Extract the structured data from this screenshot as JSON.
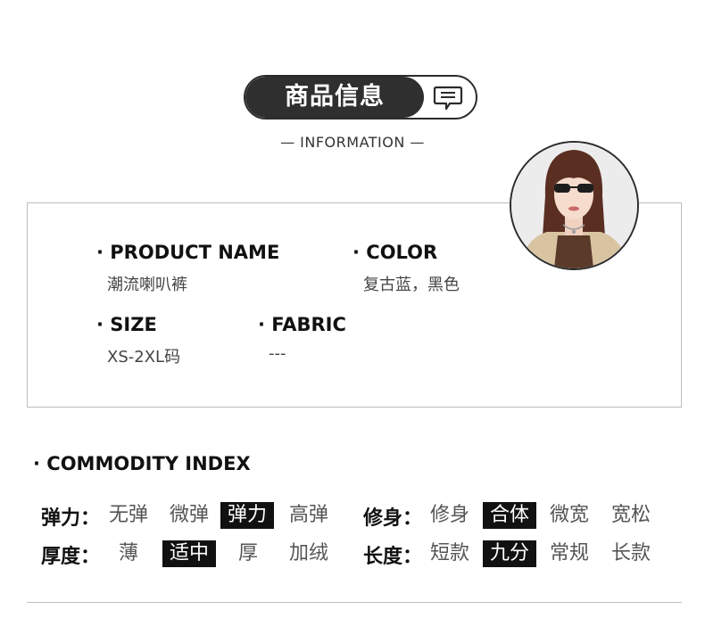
{
  "header": {
    "title": "商品信息",
    "subtitle": "— INFORMATION —"
  },
  "info": {
    "product_name_label": "· PRODUCT NAME",
    "product_name_value": "潮流喇叭裤",
    "color_label": "· COLOR",
    "color_value": "复古蓝，黑色",
    "size_label": "· SIZE",
    "size_value": "XS-2XL码",
    "fabric_label": "· FABRIC",
    "fabric_value": "---"
  },
  "commodity_index": {
    "title": "· COMMODITY INDEX",
    "elasticity": {
      "label": "弹力：",
      "options": [
        "无弹",
        "微弹",
        "弹力",
        "高弹"
      ],
      "selected": "弹力"
    },
    "fit": {
      "label": "修身：",
      "options": [
        "修身",
        "合体",
        "微宽",
        "宽松"
      ],
      "selected": "合体"
    },
    "thickness": {
      "label": "厚度：",
      "options": [
        "薄",
        "适中",
        "厚",
        "加绒"
      ],
      "selected": "适中"
    },
    "length": {
      "label": "长度：",
      "options": [
        "短款",
        "九分",
        "常规",
        "长款"
      ],
      "selected": "九分"
    }
  },
  "colors": {
    "dark": "#2f2f2f",
    "border": "#bdbdbd",
    "selected_bg": "#111111"
  }
}
